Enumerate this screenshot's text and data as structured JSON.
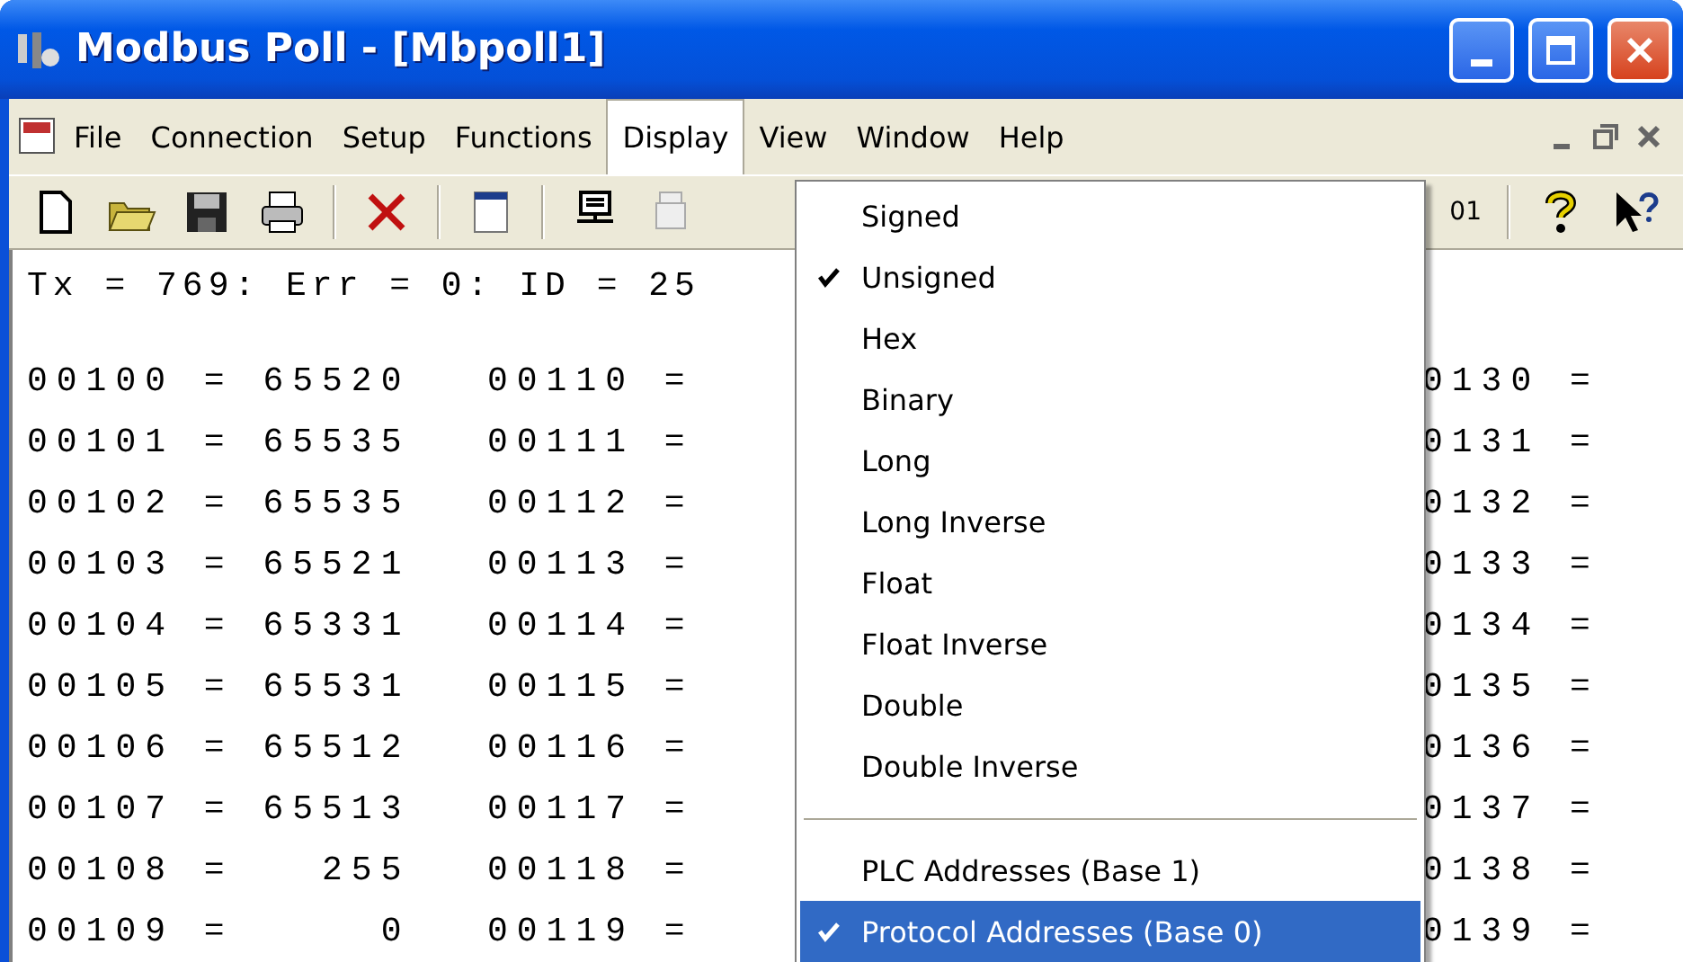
{
  "window": {
    "title": "Modbus Poll - [Mbpoll1]"
  },
  "menu_bar": [
    {
      "label": "File",
      "selected": false
    },
    {
      "label": "Connection",
      "selected": false
    },
    {
      "label": "Setup",
      "selected": false
    },
    {
      "label": "Functions",
      "selected": false
    },
    {
      "label": "Display",
      "selected": true
    },
    {
      "label": "View",
      "selected": false
    },
    {
      "label": "Window",
      "selected": false
    },
    {
      "label": "Help",
      "selected": false
    }
  ],
  "toolbar": {
    "partial_text": "01"
  },
  "status_line": "Tx = 769: Err = 0: ID = 25",
  "register_columns": [
    [
      "00100 = 65520",
      "00101 = 65535",
      "00102 = 65535",
      "00103 = 65521",
      "00104 = 65331",
      "00105 = 65531",
      "00106 = 65512",
      "00107 = 65513",
      "00108 =   255",
      "00109 =     0"
    ],
    [
      "00110 =",
      "00111 =",
      "00112 =",
      "00113 =",
      "00114 =",
      "00115 =",
      "00116 =",
      "00117 =",
      "00118 =",
      "00119 ="
    ]
  ],
  "partial_column": [
    "0130 =",
    "0131 =",
    "0132 =",
    "0133 =",
    "0134 =",
    "0135 =",
    "0136 =",
    "0137 =",
    "0138 =",
    "0139 ="
  ],
  "display_menu": [
    {
      "kind": "item",
      "label": "Signed",
      "checked": false,
      "highlighted": false
    },
    {
      "kind": "item",
      "label": "Unsigned",
      "checked": true,
      "highlighted": false
    },
    {
      "kind": "item",
      "label": "Hex",
      "checked": false,
      "highlighted": false
    },
    {
      "kind": "item",
      "label": "Binary",
      "checked": false,
      "highlighted": false
    },
    {
      "kind": "item",
      "label": "Long",
      "checked": false,
      "highlighted": false
    },
    {
      "kind": "item",
      "label": "Long Inverse",
      "checked": false,
      "highlighted": false
    },
    {
      "kind": "item",
      "label": "Float",
      "checked": false,
      "highlighted": false
    },
    {
      "kind": "item",
      "label": "Float Inverse",
      "checked": false,
      "highlighted": false
    },
    {
      "kind": "item",
      "label": "Double",
      "checked": false,
      "highlighted": false
    },
    {
      "kind": "item",
      "label": "Double Inverse",
      "checked": false,
      "highlighted": false
    },
    {
      "kind": "separator"
    },
    {
      "kind": "item",
      "label": "PLC Addresses (Base 1)",
      "checked": false,
      "highlighted": false
    },
    {
      "kind": "item",
      "label": "Protocol Addresses (Base 0)",
      "checked": true,
      "highlighted": true
    }
  ]
}
